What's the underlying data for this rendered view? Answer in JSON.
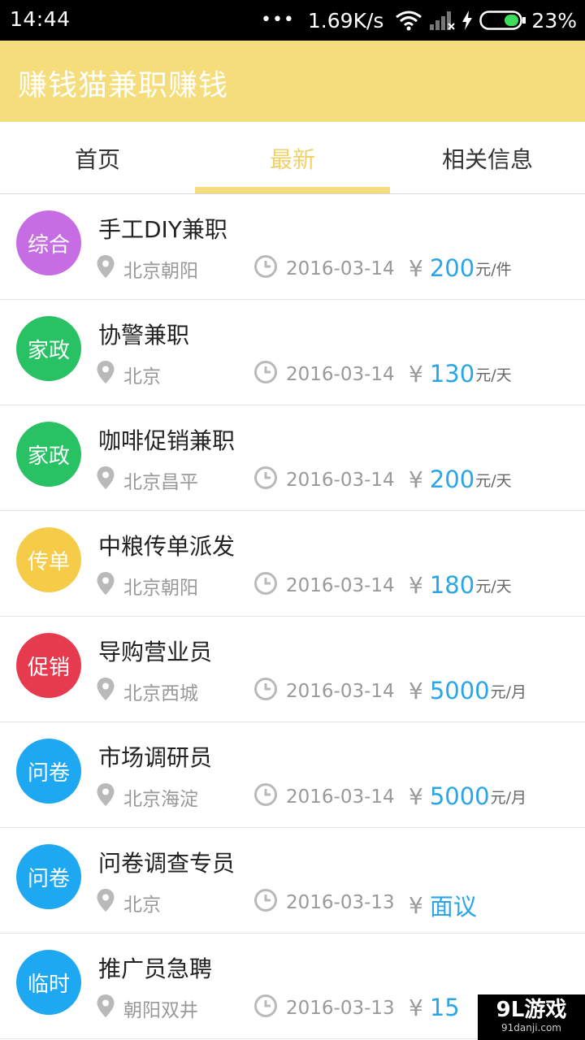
{
  "status_bar": {
    "time": "14:44",
    "dots": "•••",
    "network_speed": "1.69K/s",
    "battery": "23%",
    "icons": [
      "wifi-icon",
      "signal-icon",
      "charging-icon",
      "battery-icon"
    ]
  },
  "app": {
    "title": "赚钱猫兼职赚钱",
    "accent": "#f6dd7b"
  },
  "tabs": [
    {
      "label": "首页"
    },
    {
      "label": "最新"
    },
    {
      "label": "相关信息"
    }
  ],
  "jobs": [
    {
      "category": "综合",
      "title": "手工DIY兼职",
      "location": "北京朝阳",
      "date": "2016-03-14",
      "yen": "¥",
      "amount": "200",
      "unit": "元/件",
      "color": "#c66de4"
    },
    {
      "category": "家政",
      "title": "协警兼职",
      "location": "北京",
      "date": "2016-03-14",
      "yen": "¥",
      "amount": "130",
      "unit": "元/天",
      "color": "#28c264"
    },
    {
      "category": "家政",
      "title": "咖啡促销兼职",
      "location": "北京昌平",
      "date": "2016-03-14",
      "yen": "¥",
      "amount": "200",
      "unit": "元/天",
      "color": "#28c264"
    },
    {
      "category": "传单",
      "title": "中粮传单派发",
      "location": "北京朝阳",
      "date": "2016-03-14",
      "yen": "¥",
      "amount": "180",
      "unit": "元/天",
      "color": "#f5cb47"
    },
    {
      "category": "促销",
      "title": "导购营业员",
      "location": "北京西城",
      "date": "2016-03-14",
      "yen": "¥",
      "amount": "5000",
      "unit": "元/月",
      "color": "#e63a4f"
    },
    {
      "category": "问卷",
      "title": "市场调研员",
      "location": "北京海淀",
      "date": "2016-03-14",
      "yen": "¥",
      "amount": "5000",
      "unit": "元/月",
      "color": "#1ea8f1"
    },
    {
      "category": "问卷",
      "title": "问卷调查专员",
      "location": "北京",
      "date": "2016-03-13",
      "yen": "¥",
      "amount": "面议",
      "unit": "",
      "color": "#1ea8f1"
    },
    {
      "category": "临时",
      "title": "推广员急聘",
      "location": "朝阳双井",
      "date": "2016-03-13",
      "yen": "¥",
      "amount": "15",
      "unit": "",
      "color": "#1ea8f1"
    }
  ],
  "watermark": {
    "main": "9L游戏",
    "sub": "91danji.com"
  }
}
